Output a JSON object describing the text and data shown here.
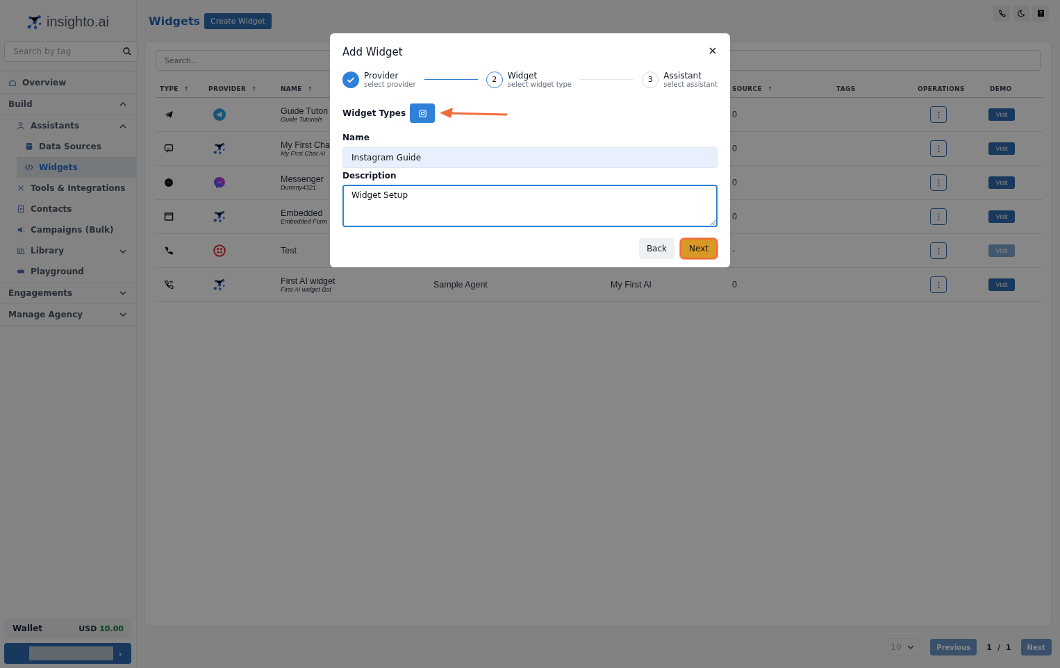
{
  "sidebar": {
    "logo": "insighto.ai",
    "search": {
      "placeholder": "Search by tag"
    },
    "nav": [
      {
        "label": "Overview",
        "kind": "link"
      },
      {
        "label": "Build",
        "kind": "section",
        "expanded": true,
        "children": [
          {
            "label": "Assistants",
            "expanded": true,
            "children": [
              {
                "label": "Data Sources",
                "selected": false
              },
              {
                "label": "Widgets",
                "selected": true
              }
            ]
          },
          {
            "label": "Tools & Integrations"
          },
          {
            "label": "Contacts"
          },
          {
            "label": "Campaigns (Bulk)"
          },
          {
            "label": "Library",
            "expanded": false
          },
          {
            "label": "Playground"
          }
        ]
      },
      {
        "label": "Engagements",
        "kind": "section",
        "expanded": false
      },
      {
        "label": "Manage Agency",
        "kind": "section",
        "expanded": false
      }
    ],
    "wallet": {
      "label": "Wallet",
      "currency": "USD",
      "amount": "10.00"
    },
    "account_chevron": "›"
  },
  "header": {
    "title": "Widgets",
    "create_button": "Create Widget"
  },
  "table": {
    "search": {
      "placeholder": "Search..."
    },
    "columns": [
      {
        "label": "TYPE",
        "sort_mark": "↑"
      },
      {
        "label": "PROVIDER",
        "sort_mark": "↑"
      },
      {
        "label": "NAME",
        "sort_mark": "↑"
      },
      {
        "label": "SOURCE",
        "sort_mark": "↑"
      },
      {
        "label": "TAGS"
      },
      {
        "label": "OPERATIONS"
      },
      {
        "label": "DEMO"
      }
    ],
    "rows": [
      {
        "type": {
          "kind": "telegram"
        },
        "provider": {
          "kind": "telegram"
        },
        "name": "Guide Tutori",
        "subtitle": "Guide Tutorials",
        "source": "0",
        "demo": "Visit",
        "demo_enabled": true
      },
      {
        "type": {
          "kind": "chat"
        },
        "provider": {
          "kind": "insighto"
        },
        "name": "My First Cha",
        "subtitle": "My First Chat AI",
        "source": "0",
        "demo": "Visit",
        "demo_enabled": true
      },
      {
        "type": {
          "kind": "messenger"
        },
        "provider": {
          "kind": "messenger"
        },
        "name": "Messenger",
        "subtitle": "Dummy4321",
        "source": "0",
        "demo": "Visit",
        "demo_enabled": true
      },
      {
        "type": {
          "kind": "window"
        },
        "provider": {
          "kind": "insighto"
        },
        "name": "Embedded",
        "subtitle": "Embedded Form",
        "source": "0",
        "demo": "Visit",
        "demo_enabled": true
      },
      {
        "type": {
          "kind": "phone"
        },
        "provider": {
          "kind": "twilio"
        },
        "name": "Test",
        "source": "-",
        "demo": "Visit",
        "demo_enabled": false
      },
      {
        "type": {
          "kind": "phone-wifi"
        },
        "provider": {
          "kind": "insighto"
        },
        "name": "First AI widget",
        "subtitle": "First AI widget Bot",
        "column_4": "Sample Agent",
        "column_5": "My First AI",
        "source": "0",
        "demo": "Visit",
        "demo_enabled": true
      }
    ]
  },
  "pagination": {
    "page_size": "10",
    "previous": "Previous",
    "page": "1",
    "separator": "/",
    "total": "1",
    "next": "Next"
  },
  "modal": {
    "title": "Add Widget",
    "steps": [
      {
        "label": "Provider",
        "sub": "select provider",
        "done": true,
        "selected": false
      },
      {
        "number": "2",
        "label": "Widget",
        "sub": "select widget type",
        "done": false,
        "selected": true
      },
      {
        "number": "3",
        "label": "Assistant",
        "sub": "select assistant",
        "done": false,
        "selected": false
      }
    ],
    "widget_types_label": "Widget Types",
    "widget_types": [
      {
        "kind": "instagram",
        "selected": true
      }
    ],
    "name_label": "Name",
    "name_value": "Instagram Guide",
    "description_label": "Description",
    "description_value": "Widget Setup",
    "back": "Back",
    "next": "Next"
  }
}
